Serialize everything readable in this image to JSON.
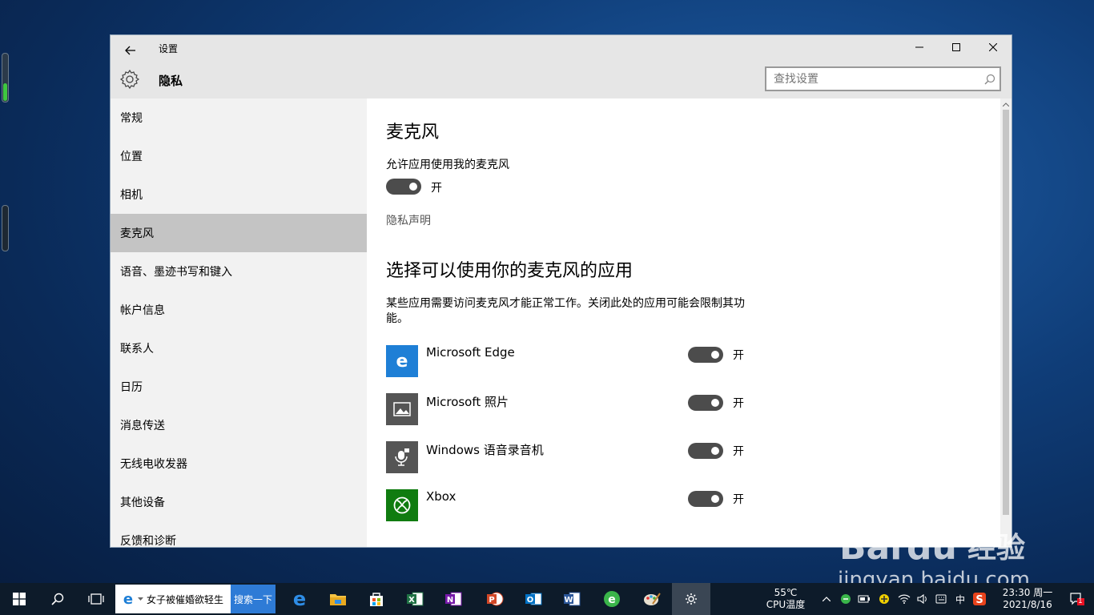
{
  "window": {
    "title": "设置",
    "section": "隐私",
    "search_placeholder": "查找设置"
  },
  "sidebar": {
    "items": [
      {
        "label": "常规"
      },
      {
        "label": "位置"
      },
      {
        "label": "相机"
      },
      {
        "label": "麦克风",
        "active": true
      },
      {
        "label": "语音、墨迹书写和键入"
      },
      {
        "label": "帐户信息"
      },
      {
        "label": "联系人"
      },
      {
        "label": "日历"
      },
      {
        "label": "消息传送"
      },
      {
        "label": "无线电收发器"
      },
      {
        "label": "其他设备"
      },
      {
        "label": "反馈和诊断"
      }
    ]
  },
  "main": {
    "heading": "麦克风",
    "allow_label": "允许应用使用我的麦克风",
    "allow_state": "开",
    "privacy_link": "隐私声明",
    "apps_heading": "选择可以使用你的麦克风的应用",
    "apps_desc": "某些应用需要访问麦克风才能正常工作。关闭此处的应用可能会限制其功能。",
    "apps": [
      {
        "name": "Microsoft Edge",
        "state": "开",
        "color": "#1e7fd6",
        "icon": "edge-icon"
      },
      {
        "name": "Microsoft 照片",
        "state": "开",
        "color": "#555555",
        "icon": "photos-icon"
      },
      {
        "name": "Windows 语音录音机",
        "state": "开",
        "color": "#555555",
        "icon": "voice-recorder-icon"
      },
      {
        "name": "Xbox",
        "state": "开",
        "color": "#107c10",
        "icon": "xbox-icon"
      }
    ]
  },
  "taskbar": {
    "search_text": "女子被催婚欲轻生",
    "search_button": "搜索一下",
    "temp": "55℃",
    "temp_label": "CPU温度",
    "ime": "中",
    "time": "23:30 周一",
    "date": "2021/8/16",
    "notification_count": "1"
  },
  "watermark": {
    "brand": "Baidu",
    "brand_cn": "经验",
    "url": "jingyan.baidu.com"
  }
}
